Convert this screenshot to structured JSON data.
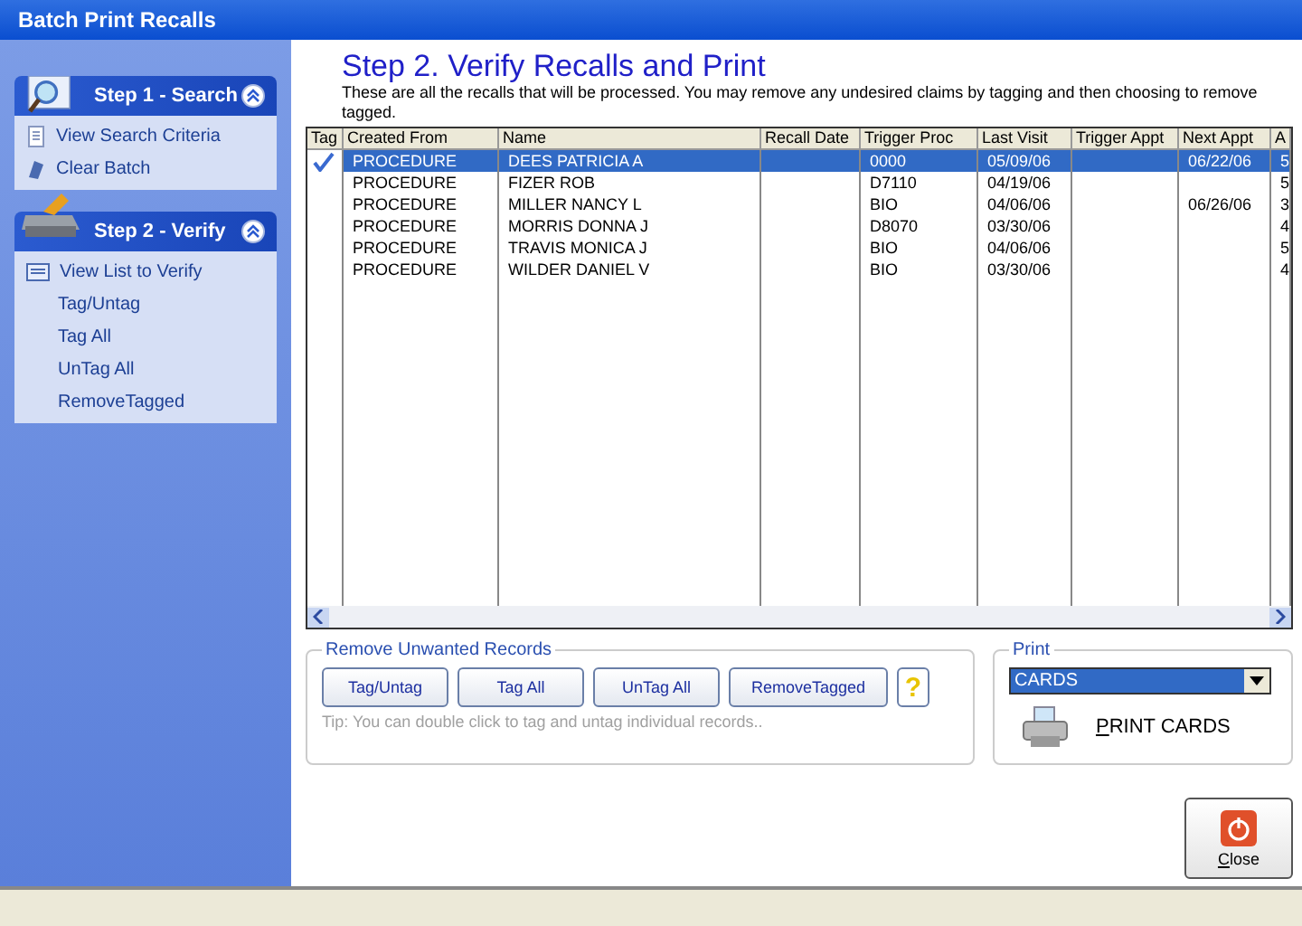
{
  "window": {
    "title": "Batch Print Recalls"
  },
  "sidebar": {
    "groups": [
      {
        "title": "Step 1 - Search",
        "expanded": true,
        "items": [
          {
            "label": "View Search Criteria"
          },
          {
            "label": "Clear Batch"
          }
        ]
      },
      {
        "title": "Step 2 - Verify",
        "expanded": true,
        "items": [
          {
            "label": "View List to Verify"
          },
          {
            "label": "Tag/Untag"
          },
          {
            "label": "Tag All"
          },
          {
            "label": "UnTag All"
          },
          {
            "label": "RemoveTagged"
          }
        ]
      }
    ]
  },
  "heading": "Step 2. Verify Recalls and Print",
  "description": "These are all the recalls that will be processed. You may remove any undesired claims by tagging and then choosing to remove tagged.",
  "table": {
    "columns": [
      "Tag",
      "Created From",
      "Name",
      "Recall Date",
      "Trigger Proc",
      "Last Visit",
      "Trigger Appt",
      "Next Appt",
      "A"
    ],
    "rows": [
      {
        "tagged": true,
        "selected": true,
        "cells": [
          "",
          "PROCEDURE",
          "DEES PATRICIA A",
          "",
          "0000",
          "05/09/06",
          "",
          "06/22/06",
          "5"
        ]
      },
      {
        "tagged": false,
        "selected": false,
        "cells": [
          "",
          "PROCEDURE",
          "FIZER ROB",
          "",
          "D7110",
          "04/19/06",
          "",
          "",
          "5"
        ]
      },
      {
        "tagged": false,
        "selected": false,
        "cells": [
          "",
          "PROCEDURE",
          "MILLER NANCY L",
          "",
          "BIO",
          "04/06/06",
          "",
          "06/26/06",
          "3"
        ]
      },
      {
        "tagged": false,
        "selected": false,
        "cells": [
          "",
          "PROCEDURE",
          "MORRIS DONNA J",
          "",
          "D8070",
          "03/30/06",
          "",
          "",
          "4"
        ]
      },
      {
        "tagged": false,
        "selected": false,
        "cells": [
          "",
          "PROCEDURE",
          "TRAVIS MONICA J",
          "",
          "BIO",
          "04/06/06",
          "",
          "",
          "5"
        ]
      },
      {
        "tagged": false,
        "selected": false,
        "cells": [
          "",
          "PROCEDURE",
          "WILDER DANIEL V",
          "",
          "BIO",
          "03/30/06",
          "",
          "",
          "4"
        ]
      }
    ]
  },
  "remove_group": {
    "title": "Remove Unwanted Records",
    "buttons": [
      "Tag/Untag",
      "Tag All",
      "UnTag All",
      "RemoveTagged"
    ],
    "help": "?",
    "tip": "Tip: You can double click to tag and untag individual records.."
  },
  "print_group": {
    "title": "Print",
    "selection": "CARDS",
    "print_button": "PRINT CARDS"
  },
  "close_button": "Close"
}
